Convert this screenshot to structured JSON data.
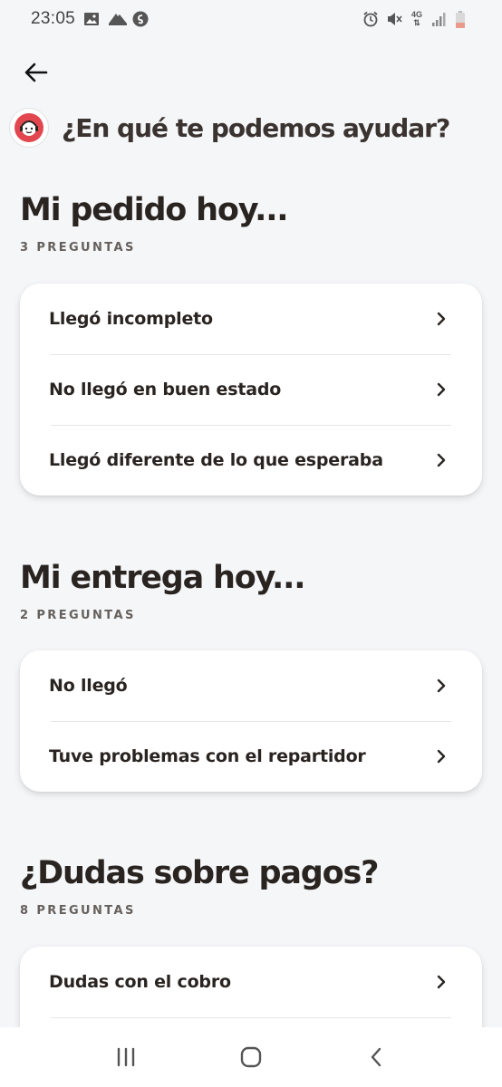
{
  "status_bar": {
    "time": "23:05",
    "left_icons": [
      "image-icon",
      "shoe-icon",
      "shazam-icon"
    ],
    "right_icons": [
      "alarm-icon",
      "mute-icon",
      "4g-icon",
      "signal-icon",
      "battery-icon"
    ],
    "network_label": "4G"
  },
  "header": {
    "title": "¿En qué te podemos ayudar?"
  },
  "sections": [
    {
      "title": "Mi pedido hoy...",
      "count": "3 PREGUNTAS",
      "items": [
        "Llegó incompleto",
        "No llegó en buen estado",
        "Llegó diferente de lo que esperaba"
      ]
    },
    {
      "title": "Mi entrega hoy...",
      "count": "2 PREGUNTAS",
      "items": [
        "No llegó",
        "Tuve problemas con el repartidor"
      ]
    },
    {
      "title": "¿Dudas sobre pagos?",
      "count": "8 PREGUNTAS",
      "items": [
        "Dudas con el cobro",
        ""
      ]
    }
  ],
  "colors": {
    "background": "#f5f6f8",
    "card": "#ffffff",
    "text_primary": "#2a2421",
    "avatar_accent": "#e2474f"
  }
}
